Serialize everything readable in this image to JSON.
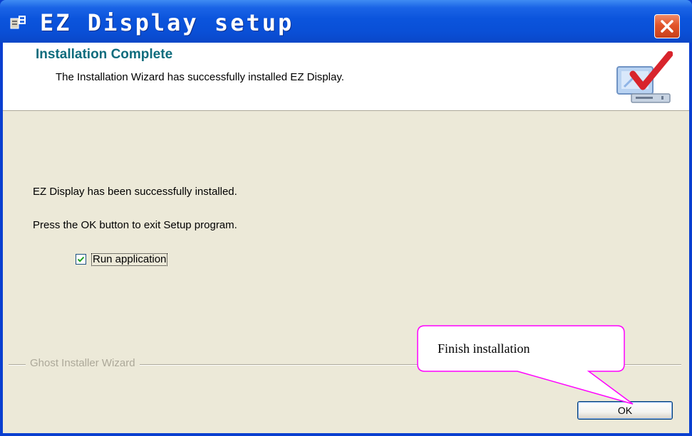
{
  "window": {
    "title": "EZ Display setup",
    "close_icon": "close-icon",
    "title_bar_color": "#0a4fd6"
  },
  "header": {
    "title": "Installation Complete",
    "subtitle": "The Installation Wizard has successfully installed EZ Display.",
    "logo_icon": "computer-checkmark-icon"
  },
  "body": {
    "line1": "EZ Display has been successfully installed.",
    "line2": "Press the OK button to exit Setup program.",
    "run_app": {
      "label": "Run application",
      "checked": true
    }
  },
  "footer": {
    "group_label": "Ghost Installer Wizard",
    "ok_label": "OK"
  },
  "annotation": {
    "text": "Finish installation",
    "border_color": "#ff00ff"
  }
}
